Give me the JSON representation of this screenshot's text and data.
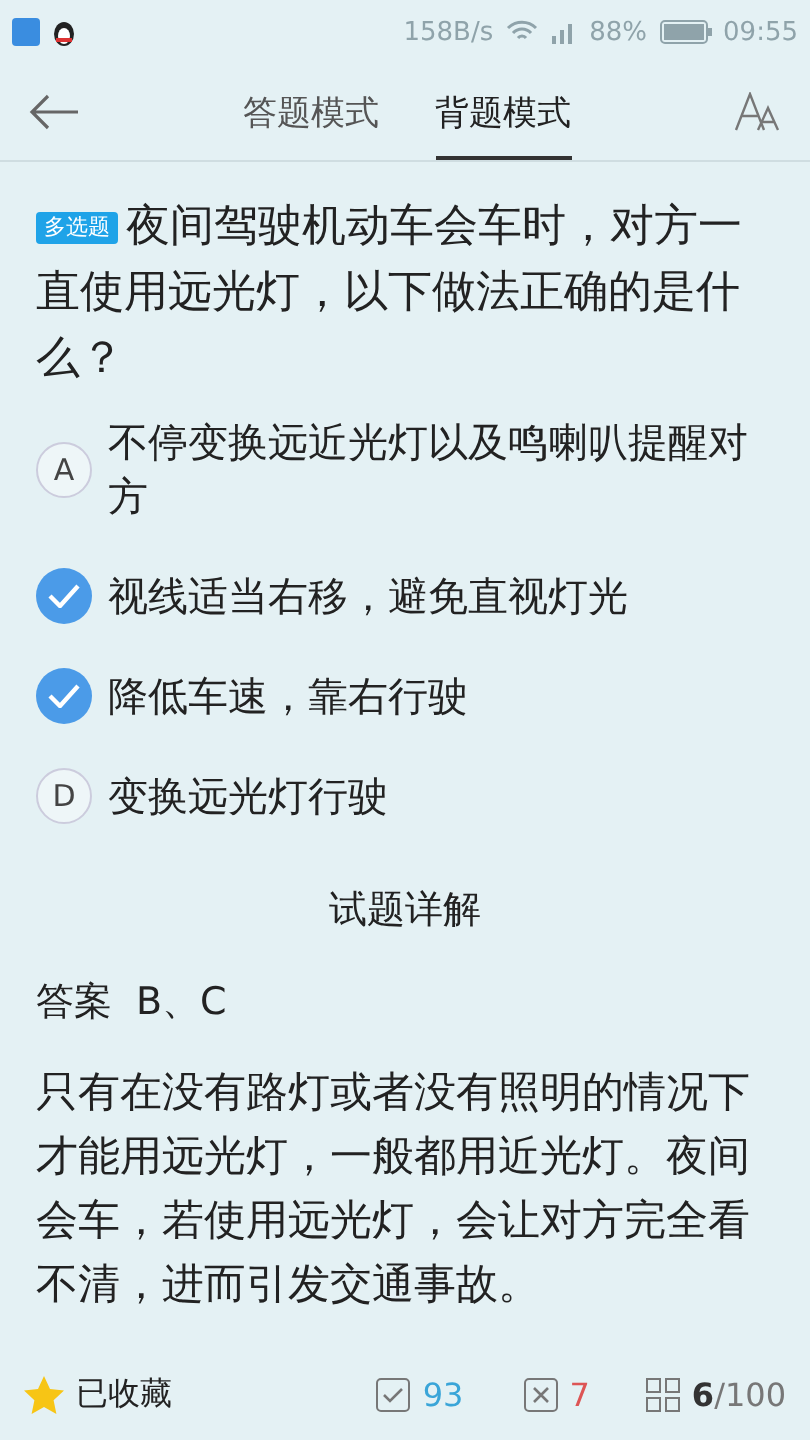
{
  "status_bar": {
    "speed": "158B/s",
    "battery": "88%",
    "time": "09:55"
  },
  "header": {
    "tabs": [
      {
        "label": "答题模式",
        "selected": false
      },
      {
        "label": "背题模式",
        "selected": true
      }
    ]
  },
  "question": {
    "tag": "多选题",
    "text": "夜间驾驶机动车会车时，对方一直使用远光灯，以下做法正确的是什么？",
    "options": [
      {
        "letter": "A",
        "text": "不停变换远近光灯以及鸣喇叭提醒对方",
        "selected": false
      },
      {
        "text": "视线适当右移，避免直视灯光",
        "selected": true
      },
      {
        "text": "降低车速，靠右行驶",
        "selected": true
      },
      {
        "letter": "D",
        "text": "变换远光灯行驶",
        "selected": false
      }
    ]
  },
  "detail": {
    "title": "试题详解",
    "answer_label": "答案",
    "answer": "B、C",
    "explanation": "只有在没有路灯或者没有照明的情况下才能用远光灯，一般都用近光灯。夜间会车，若使用远光灯，会让对方完全看不清，进而引发交通事故。"
  },
  "bottom_bar": {
    "favorite": "已收藏",
    "correct": "93",
    "wrong": "7",
    "progress": "**6**/100"
  }
}
